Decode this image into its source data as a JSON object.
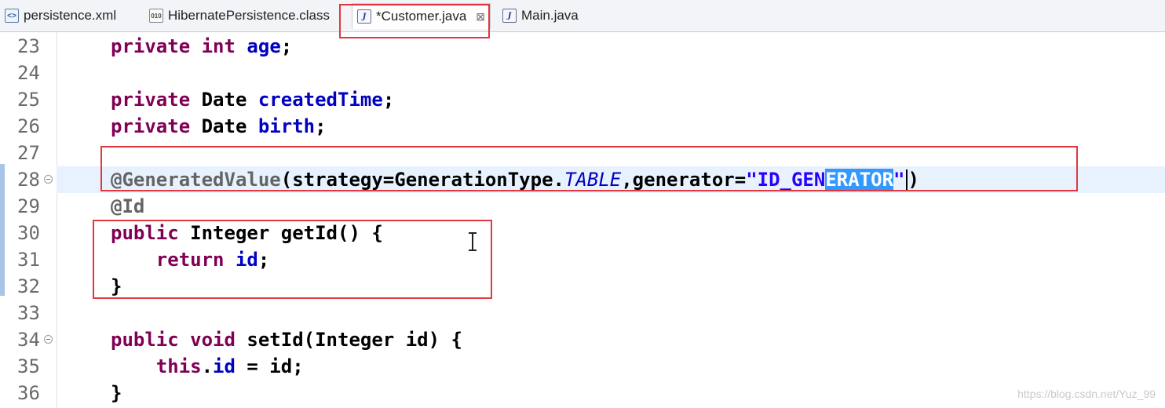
{
  "tabs": [
    {
      "label": "persistence.xml",
      "icon": "xml-file-icon"
    },
    {
      "label": "HibernatePersistence.class",
      "icon": "class-file-icon"
    },
    {
      "label": "*Customer.java",
      "icon": "java-file-icon",
      "active": true
    },
    {
      "label": "Main.java",
      "icon": "java-file-icon"
    }
  ],
  "editor": {
    "current_line": 28,
    "lines": [
      {
        "n": "23",
        "tokens": [
          {
            "t": "private",
            "k": "kw"
          },
          {
            "t": " "
          },
          {
            "t": "int",
            "k": "kw"
          },
          {
            "t": " "
          },
          {
            "t": "age",
            "k": "fld"
          },
          {
            "t": ";"
          }
        ]
      },
      {
        "n": "24",
        "tokens": []
      },
      {
        "n": "25",
        "tokens": [
          {
            "t": "private",
            "k": "kw"
          },
          {
            "t": " Date "
          },
          {
            "t": "createdTime",
            "k": "fld"
          },
          {
            "t": ";"
          }
        ]
      },
      {
        "n": "26",
        "tokens": [
          {
            "t": "private",
            "k": "kw"
          },
          {
            "t": " Date "
          },
          {
            "t": "birth",
            "k": "fld"
          },
          {
            "t": ";"
          }
        ]
      },
      {
        "n": "27",
        "tokens": []
      },
      {
        "n": "28",
        "fold": true,
        "tokens": [
          {
            "t": "@GeneratedValue",
            "k": "ann"
          },
          {
            "t": "(strategy=GenerationType."
          },
          {
            "t": "TABLE",
            "k": "ital"
          },
          {
            "t": ",generator="
          },
          {
            "t": "\"ID_GEN",
            "k": "str"
          },
          {
            "t": "ERATOR",
            "k": "sel"
          },
          {
            "t": "\"",
            "k": "str"
          },
          {
            "t": "",
            "k": "caret"
          },
          {
            "t": ")"
          }
        ]
      },
      {
        "n": "29",
        "tokens": [
          {
            "t": "@Id",
            "k": "ann"
          }
        ]
      },
      {
        "n": "30",
        "tokens": [
          {
            "t": "public",
            "k": "kw"
          },
          {
            "t": " Integer getId() {"
          }
        ]
      },
      {
        "n": "31",
        "tokens": [
          {
            "t": "    "
          },
          {
            "t": "return",
            "k": "kw"
          },
          {
            "t": " "
          },
          {
            "t": "id",
            "k": "fld"
          },
          {
            "t": ";"
          }
        ]
      },
      {
        "n": "32",
        "tokens": [
          {
            "t": "}"
          }
        ]
      },
      {
        "n": "33",
        "tokens": []
      },
      {
        "n": "34",
        "fold": true,
        "tokens": [
          {
            "t": "public",
            "k": "kw"
          },
          {
            "t": " "
          },
          {
            "t": "void",
            "k": "kw"
          },
          {
            "t": " setId(Integer id) {"
          }
        ]
      },
      {
        "n": "35",
        "tokens": [
          {
            "t": "    "
          },
          {
            "t": "this",
            "k": "kw"
          },
          {
            "t": "."
          },
          {
            "t": "id",
            "k": "fld"
          },
          {
            "t": " = id;"
          }
        ]
      },
      {
        "n": "36",
        "tokens": [
          {
            "t": "}"
          }
        ]
      }
    ]
  },
  "watermark": "https://blog.csdn.net/Yuz_99"
}
